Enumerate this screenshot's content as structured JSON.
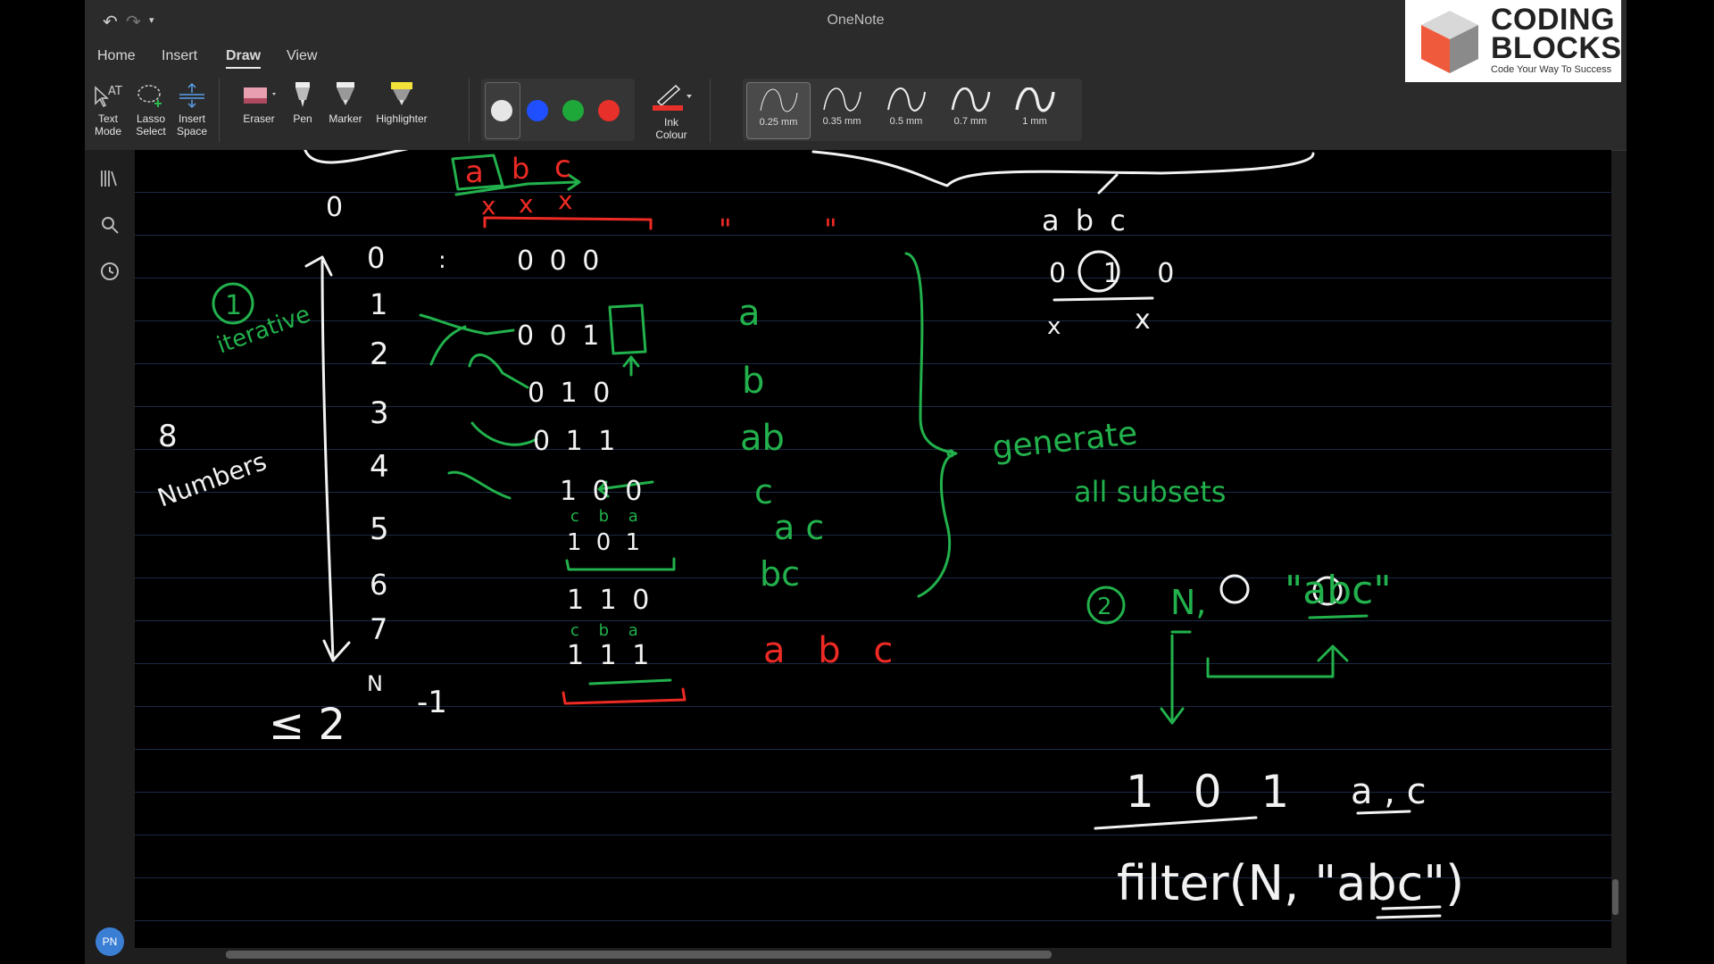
{
  "app": {
    "title": "OneNote"
  },
  "quick_access": {
    "undo_icon": "undo-icon",
    "redo_icon": "redo-icon",
    "customize_icon": "chevron-down-icon"
  },
  "menu": {
    "tabs": [
      "Home",
      "Insert",
      "Draw",
      "View"
    ],
    "active": "Draw"
  },
  "ribbon": {
    "tools": {
      "text_mode": "Text Mode",
      "lasso_select": "Lasso Select",
      "insert_space": "Insert Space",
      "eraser": "Eraser",
      "pen": "Pen",
      "marker": "Marker",
      "highlighter": "Highlighter",
      "ink_colour": "Ink Colour"
    },
    "pen_colors": [
      "#e6e6e6",
      "#1f4fff",
      "#1fa83a",
      "#e8302a"
    ],
    "selected_color": "#e6e6e6",
    "thicknesses": [
      "0.25 mm",
      "0.35 mm",
      "0.5 mm",
      "0.7 mm",
      "1 mm"
    ],
    "selected_thickness": "0.25 mm"
  },
  "logo": {
    "line1": "CODING",
    "line2": "BLOCKS",
    "tagline": "Code Your Way To Success"
  },
  "user": {
    "initials": "PN"
  },
  "ink": {
    "colors": {
      "white": "#f2f2f2",
      "green": "#22b14c",
      "red": "#ee2a24"
    },
    "white_texts": [
      "0",
      "0",
      "1",
      "2",
      "3",
      "4",
      "5",
      "6",
      "7",
      ":",
      "0 0 0",
      "0 0 1",
      "0 1 0",
      "0 1 1",
      "1 0 0",
      "1 0 1",
      "1 1 0",
      "1 1 1",
      "8",
      "Numbers",
      "≤ 2",
      "N",
      "-1",
      "a b c",
      "0 1 0",
      "x",
      "x",
      "1 0 1",
      "a , c",
      "filter(N, \"abc\")"
    ],
    "green_texts": [
      "1",
      "iterative",
      "a",
      "b",
      "ab",
      "c",
      "a c",
      "bc",
      "c b a",
      "c b a",
      "generate",
      "all subsets",
      "2",
      "N,",
      "\"abc\""
    ],
    "red_texts": [
      "a",
      "b",
      "c",
      "x",
      "x",
      "x",
      "\"",
      "\"",
      "a b c"
    ]
  }
}
